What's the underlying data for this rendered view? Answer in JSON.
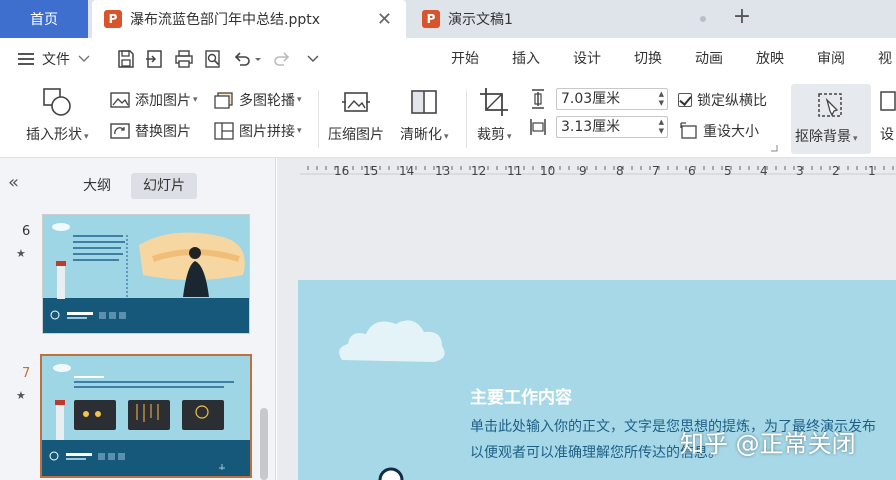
{
  "tabs": {
    "home_label": "首页",
    "doc1": {
      "icon_letter": "P",
      "title": "瀑布流蓝色部门年中总结.pptx"
    },
    "doc2": {
      "icon_letter": "P",
      "title": "演示文稿1"
    },
    "close_glyph": "✕",
    "add_glyph": "+"
  },
  "menu": {
    "file_label": "文件",
    "nav_tabs": [
      "开始",
      "插入",
      "设计",
      "切换",
      "动画",
      "放映",
      "审阅",
      "视"
    ]
  },
  "ribbon": {
    "insert_shape": "插入形状",
    "add_image": "添加图片",
    "replace_image": "替换图片",
    "multi_carousel": "多图轮播",
    "image_collage": "图片拼接",
    "compress_image": "压缩图片",
    "sharpen": "清晰化",
    "crop": "裁剪",
    "width_value": "7.03厘米",
    "height_value": "3.13厘米",
    "lock_ratio": "锁定纵横比",
    "reset_size": "重设大小",
    "remove_background": "抠除背景",
    "settings_partial": "设"
  },
  "panel": {
    "tab_outline": "大纲",
    "tab_slides": "幻灯片",
    "slides": [
      {
        "number": "6",
        "star": "★"
      },
      {
        "number": "7",
        "star": "★"
      }
    ]
  },
  "ruler_labels": [
    "16",
    "15",
    "14",
    "13",
    "12",
    "11",
    "10",
    "9",
    "8",
    "7",
    "6",
    "5",
    "4",
    "3",
    "2",
    "1"
  ],
  "slide": {
    "title": "主要工作内容",
    "body_line1": "单击此处输入你的正文，文字是您思想的提炼，为了最终演示发布",
    "body_line2": "以便观者可以准确理解您所传达的信息。"
  },
  "watermark": "知乎 @正常关闭",
  "colors": {
    "home_tab": "#3e6fcf",
    "ppt_icon": "#d9532c",
    "slide_bg": "#a6d8e8",
    "slide_dark_band": "#15587a",
    "selected_thumb_border": "#c0703a"
  }
}
